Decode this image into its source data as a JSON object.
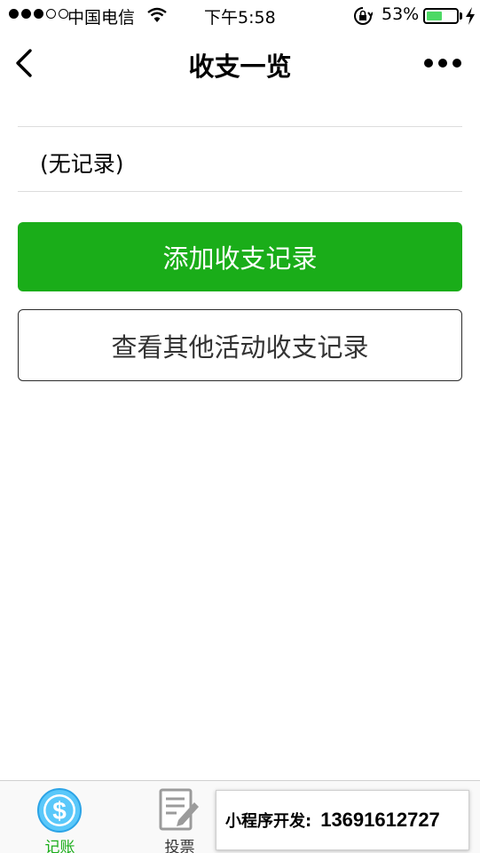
{
  "status_bar": {
    "carrier": "中国电信",
    "time": "下午5:58",
    "battery_percent": "53%",
    "battery_level": 0.53,
    "battery_color": "#4cd964"
  },
  "nav": {
    "title": "收支一览",
    "back_icon": "chevron-left-icon",
    "more_icon": "more-dots-icon"
  },
  "records": {
    "empty_text": "(无记录)"
  },
  "actions": {
    "add_label": "添加收支记录",
    "view_other_label": "查看其他活动收支记录",
    "primary_color": "#1aad19"
  },
  "tabs": [
    {
      "label": "记账",
      "icon": "dollar-icon",
      "active": true
    },
    {
      "label": "投票",
      "icon": "vote-icon",
      "active": false
    }
  ],
  "ad_banner": {
    "label": "小程序开发:",
    "phone": "13691612727"
  }
}
